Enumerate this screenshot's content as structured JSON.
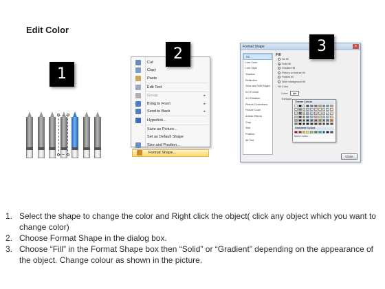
{
  "page_title": "Edit Color",
  "badges": [
    "1",
    "2",
    "3"
  ],
  "context_menu": {
    "items": [
      {
        "label": "Cut",
        "icon": "scissors-icon",
        "color": "#6a88b8"
      },
      {
        "label": "Copy",
        "icon": "copy-icon",
        "color": "#7f9cc7"
      },
      {
        "label": "Paste",
        "icon": "paste-icon",
        "color": "#c9a55a"
      },
      {
        "label": "Edit Text",
        "icon": "edit-text-icon",
        "color": "#9aa9bb"
      },
      {
        "label": "Group",
        "icon": "group-icon",
        "color": "#b0b0b0",
        "submenu": true,
        "disabled": true
      },
      {
        "label": "Bring to Front",
        "icon": "bring-to-front-icon",
        "color": "#4d7ec2",
        "submenu": true
      },
      {
        "label": "Send to Back",
        "icon": "send-to-back-icon",
        "color": "#4d7ec2",
        "submenu": true
      },
      {
        "label": "Hyperlink...",
        "icon": "hyperlink-icon",
        "color": "#3c6cb4"
      },
      {
        "label": "Save as Picture...",
        "icon": "",
        "color": ""
      },
      {
        "label": "Set as Default Shape",
        "icon": "",
        "color": ""
      },
      {
        "label": "Size and Position...",
        "icon": "size-position-icon",
        "color": "#6b8fbf"
      },
      {
        "label": "Format Shape...",
        "icon": "format-shape-icon",
        "color": "#d08a2e",
        "highlighted": true
      }
    ]
  },
  "format_dialog": {
    "title": "Format Shape",
    "close_glyph": "x",
    "categories": [
      "Fill",
      "Line Color",
      "Line Style",
      "Shadow",
      "Reflection",
      "Glow and Soft Edges",
      "3-D Format",
      "3-D Rotation",
      "Picture Corrections",
      "Picture Color",
      "Artistic Effects",
      "Crop",
      "Size",
      "Position",
      "Alt Text"
    ],
    "selected_category": "Fill",
    "fill_heading": "Fill",
    "fill_options": [
      {
        "label": "No fill",
        "checked": false
      },
      {
        "label": "Solid fill",
        "checked": true
      },
      {
        "label": "Gradient fill",
        "checked": false
      },
      {
        "label": "Picture or texture fill",
        "checked": false
      },
      {
        "label": "Pattern fill",
        "checked": false
      },
      {
        "label": "Slide background fill",
        "checked": false
      }
    ],
    "fill_color_label": "Fill Color",
    "color_label": "Color:",
    "transparency_label": "Transpar...",
    "close_button": "Close"
  },
  "palette": {
    "theme_colors_label": "Theme Colors",
    "standard_colors_label": "Standard Colors",
    "more_colors_label": "More Colors...",
    "theme_rows": [
      [
        "#ffffff",
        "#000000",
        "#eeece1",
        "#1f497d",
        "#4f81bd",
        "#c0504d",
        "#9bbb59",
        "#8064a2",
        "#4bacc6",
        "#f79646"
      ],
      [
        "#f2f2f2",
        "#7f7f7f",
        "#ddd9c3",
        "#c6d9f0",
        "#dbe5f1",
        "#f2dcdb",
        "#ebf1dd",
        "#e5e0ec",
        "#dbeef3",
        "#fdeada"
      ],
      [
        "#d8d8d8",
        "#595959",
        "#c4bd97",
        "#8db3e2",
        "#b8cce4",
        "#e5b9b7",
        "#d7e3bc",
        "#ccc1d9",
        "#b7dde8",
        "#fbd5b5"
      ],
      [
        "#bfbfbf",
        "#3f3f3f",
        "#938953",
        "#548dd4",
        "#95b3d7",
        "#d99694",
        "#c3d69b",
        "#b2a2c7",
        "#92cddc",
        "#fac08f"
      ],
      [
        "#a5a5a5",
        "#262626",
        "#494429",
        "#17365d",
        "#366092",
        "#953734",
        "#76923c",
        "#5f497a",
        "#31859b",
        "#e36c09"
      ],
      [
        "#7f7f7f",
        "#0c0c0c",
        "#1d1b10",
        "#0f243e",
        "#244061",
        "#632423",
        "#4f6128",
        "#3f3151",
        "#205867",
        "#974806"
      ]
    ],
    "standard_row": [
      "#c00000",
      "#ff0000",
      "#ffc000",
      "#ffff00",
      "#92d050",
      "#00b050",
      "#00b0f0",
      "#0070c0",
      "#002060",
      "#7030a0"
    ]
  },
  "pencils": {
    "count": 7,
    "selected_index": 4,
    "selected_color": "#3b7fd0"
  },
  "steps": [
    {
      "num": "1.",
      "text": "Select the shape to change the color and Right click the object( click any object which you want to change color)"
    },
    {
      "num": "2.",
      "text": "Choose Format Shape in the dialog box."
    },
    {
      "num": "3.",
      "text": "Choose “Fill” in the Format Shape box then “Solid” or “Gradient” depending on the appearance of the object. Change colour as shown in the picture."
    }
  ]
}
